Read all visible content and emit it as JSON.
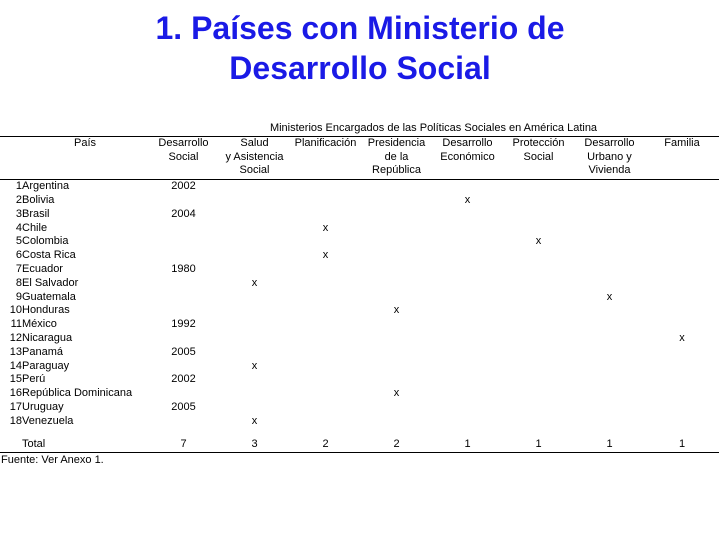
{
  "title": {
    "line1": "1. Países con Ministerio de",
    "line2": "Desarrollo Social",
    "color": "#1a1ae6"
  },
  "table": {
    "super_header": "Ministerios Encargados de las Políticas Sociales en América Latina",
    "columns": [
      {
        "key": "pais",
        "label": "País"
      },
      {
        "key": "desarrollo_social",
        "label": "Desarrollo\nSocial",
        "l1": "Desarrollo",
        "l2": "Social",
        "l3": ""
      },
      {
        "key": "salud",
        "label": "Salud y Asistencia Social",
        "l1": "Salud",
        "l2": "y Asistencia",
        "l3": "Social"
      },
      {
        "key": "planificacion",
        "label": "Planificación",
        "l1": "Planificación",
        "l2": "",
        "l3": ""
      },
      {
        "key": "presidencia",
        "label": "Presidencia de la República",
        "l1": "Presidencia",
        "l2": "de la",
        "l3": "República"
      },
      {
        "key": "desarrollo_economico",
        "label": "Desarrollo Económico",
        "l1": "Desarrollo",
        "l2": "Económico",
        "l3": ""
      },
      {
        "key": "proteccion_social",
        "label": "Protección Social",
        "l1": "Protección",
        "l2": "Social",
        "l3": ""
      },
      {
        "key": "desarrollo_urbano",
        "label": "Desarrollo Urbano y Vivienda",
        "l1": "Desarrollo",
        "l2": "Urbano y",
        "l3": "Vivienda"
      },
      {
        "key": "familia",
        "label": "Familia",
        "l1": "Familia",
        "l2": "",
        "l3": ""
      }
    ],
    "rows": [
      {
        "n": "1",
        "pais": "Argentina",
        "desarrollo_social": "2002",
        "salud": "",
        "planificacion": "",
        "presidencia": "",
        "desarrollo_economico": "",
        "proteccion_social": "",
        "desarrollo_urbano": "",
        "familia": ""
      },
      {
        "n": "2",
        "pais": "Bolivia",
        "desarrollo_social": "",
        "salud": "",
        "planificacion": "",
        "presidencia": "",
        "desarrollo_economico": "x",
        "proteccion_social": "",
        "desarrollo_urbano": "",
        "familia": ""
      },
      {
        "n": "3",
        "pais": "Brasil",
        "desarrollo_social": "2004",
        "salud": "",
        "planificacion": "",
        "presidencia": "",
        "desarrollo_economico": "",
        "proteccion_social": "",
        "desarrollo_urbano": "",
        "familia": ""
      },
      {
        "n": "4",
        "pais": "Chile",
        "desarrollo_social": "",
        "salud": "",
        "planificacion": "x",
        "presidencia": "",
        "desarrollo_economico": "",
        "proteccion_social": "",
        "desarrollo_urbano": "",
        "familia": ""
      },
      {
        "n": "5",
        "pais": "Colombia",
        "desarrollo_social": "",
        "salud": "",
        "planificacion": "",
        "presidencia": "",
        "desarrollo_economico": "",
        "proteccion_social": "x",
        "desarrollo_urbano": "",
        "familia": ""
      },
      {
        "n": "6",
        "pais": "Costa Rica",
        "desarrollo_social": "",
        "salud": "",
        "planificacion": "x",
        "presidencia": "",
        "desarrollo_economico": "",
        "proteccion_social": "",
        "desarrollo_urbano": "",
        "familia": ""
      },
      {
        "n": "7",
        "pais": "Ecuador",
        "desarrollo_social": "1980",
        "salud": "",
        "planificacion": "",
        "presidencia": "",
        "desarrollo_economico": "",
        "proteccion_social": "",
        "desarrollo_urbano": "",
        "familia": ""
      },
      {
        "n": "8",
        "pais": "El Salvador",
        "desarrollo_social": "",
        "salud": "x",
        "planificacion": "",
        "presidencia": "",
        "desarrollo_economico": "",
        "proteccion_social": "",
        "desarrollo_urbano": "",
        "familia": ""
      },
      {
        "n": "9",
        "pais": "Guatemala",
        "desarrollo_social": "",
        "salud": "",
        "planificacion": "",
        "presidencia": "",
        "desarrollo_economico": "",
        "proteccion_social": "",
        "desarrollo_urbano": "x",
        "familia": ""
      },
      {
        "n": "10",
        "pais": "Honduras",
        "desarrollo_social": "",
        "salud": "",
        "planificacion": "",
        "presidencia": "x",
        "desarrollo_economico": "",
        "proteccion_social": "",
        "desarrollo_urbano": "",
        "familia": ""
      },
      {
        "n": "11",
        "pais": "México",
        "desarrollo_social": "1992",
        "salud": "",
        "planificacion": "",
        "presidencia": "",
        "desarrollo_economico": "",
        "proteccion_social": "",
        "desarrollo_urbano": "",
        "familia": ""
      },
      {
        "n": "12",
        "pais": "Nicaragua",
        "desarrollo_social": "",
        "salud": "",
        "planificacion": "",
        "presidencia": "",
        "desarrollo_economico": "",
        "proteccion_social": "",
        "desarrollo_urbano": "",
        "familia": "x"
      },
      {
        "n": "13",
        "pais": "Panamá",
        "desarrollo_social": "2005",
        "salud": "",
        "planificacion": "",
        "presidencia": "",
        "desarrollo_economico": "",
        "proteccion_social": "",
        "desarrollo_urbano": "",
        "familia": ""
      },
      {
        "n": "14",
        "pais": "Paraguay",
        "desarrollo_social": "",
        "salud": "x",
        "planificacion": "",
        "presidencia": "",
        "desarrollo_economico": "",
        "proteccion_social": "",
        "desarrollo_urbano": "",
        "familia": ""
      },
      {
        "n": "15",
        "pais": "Perú",
        "desarrollo_social": "2002",
        "salud": "",
        "planificacion": "",
        "presidencia": "",
        "desarrollo_economico": "",
        "proteccion_social": "",
        "desarrollo_urbano": "",
        "familia": ""
      },
      {
        "n": "16",
        "pais": "República Dominicana",
        "desarrollo_social": "",
        "salud": "",
        "planificacion": "",
        "presidencia": "x",
        "desarrollo_economico": "",
        "proteccion_social": "",
        "desarrollo_urbano": "",
        "familia": ""
      },
      {
        "n": "17",
        "pais": "Uruguay",
        "desarrollo_social": "2005",
        "salud": "",
        "planificacion": "",
        "presidencia": "",
        "desarrollo_economico": "",
        "proteccion_social": "",
        "desarrollo_urbano": "",
        "familia": ""
      },
      {
        "n": "18",
        "pais": "Venezuela",
        "desarrollo_social": "",
        "salud": "x",
        "planificacion": "",
        "presidencia": "",
        "desarrollo_economico": "",
        "proteccion_social": "",
        "desarrollo_urbano": "",
        "familia": ""
      }
    ],
    "total": {
      "label": "Total",
      "desarrollo_social": "7",
      "salud": "3",
      "planificacion": "2",
      "presidencia": "2",
      "desarrollo_economico": "1",
      "proteccion_social": "1",
      "desarrollo_urbano": "1",
      "familia": "1"
    },
    "source": "Fuente: Ver Anexo 1."
  }
}
